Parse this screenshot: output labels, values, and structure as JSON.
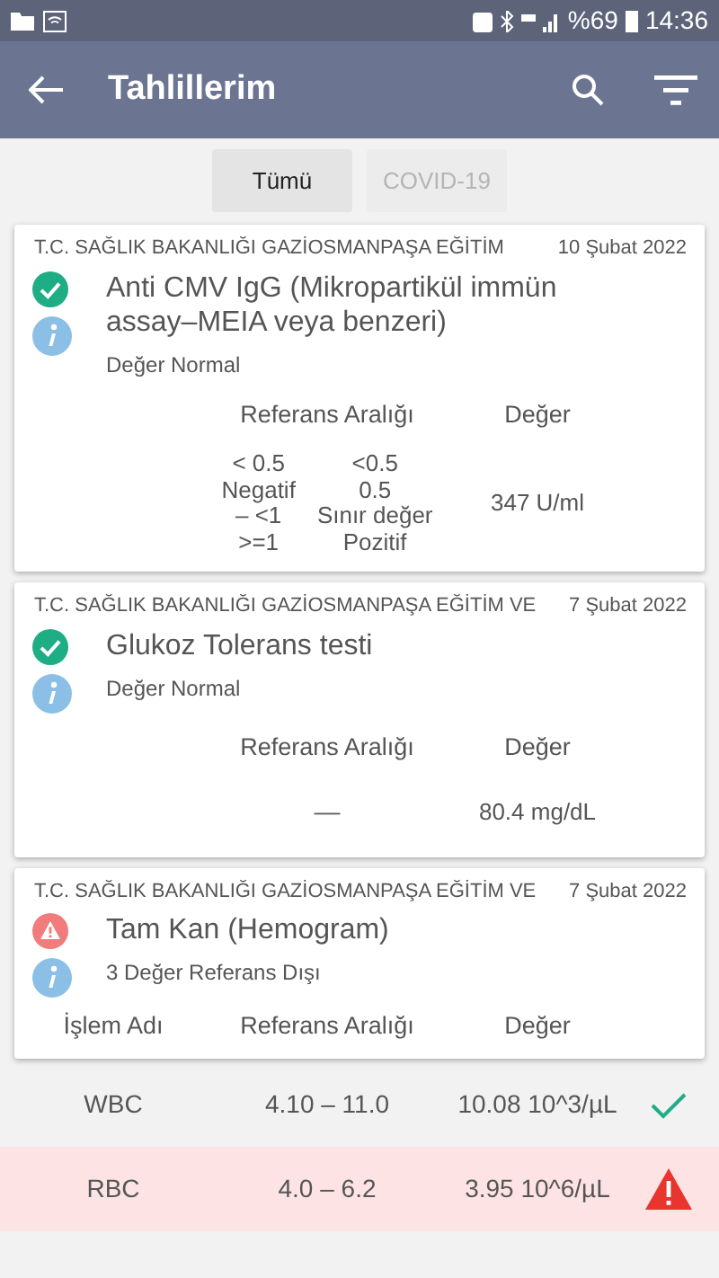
{
  "status_bar": {
    "battery_text": "%69",
    "time": "14:36"
  },
  "app_bar": {
    "title": "Tahlillerim"
  },
  "filters": [
    {
      "label": "Tümü",
      "selected": true
    },
    {
      "label": "COVID-19",
      "selected": false
    }
  ],
  "cards": [
    {
      "source": "T.C. SAĞLIK BAKANLIĞI GAZİOSMANPAŞA EĞİTİM",
      "date": "10 Şubat 2022",
      "title": "Anti CMV IgG (Mikropartikül immün assay–MEIA veya benzeri)",
      "out_of_range": false,
      "summary": "Değer Normal",
      "columns": [
        "Referans Aralığı",
        "Değer"
      ],
      "reference_rows": [
        [
          "< 0.5",
          "<0.5"
        ],
        [
          "Negatif",
          "0.5"
        ],
        [
          "– <1",
          "Sınır değer"
        ],
        [
          ">=1",
          "Pozitif"
        ]
      ],
      "value": "347 U/ml"
    },
    {
      "source": "T.C. SAĞLIK BAKANLIĞI GAZİOSMANPAŞA EĞİTİM VE",
      "date": "7 Şubat 2022",
      "title": "Glukoz Tolerans testi",
      "out_of_range": false,
      "summary": "Değer Normal",
      "columns": [
        "Referans Aralığı",
        "Değer"
      ],
      "reference": "––",
      "value": "80.4 mg/dL"
    },
    {
      "source": "T.C. SAĞLIK BAKANLIĞI GAZİOSMANPAŞA EĞİTİM VE",
      "date": "7 Şubat 2022",
      "title": "Tam Kan (Hemogram)",
      "out_of_range": true,
      "summary": "3 Değer Referans Dışı",
      "columns": [
        "İşlem Adı",
        "Referans Aralığı",
        "Değer"
      ],
      "results": [
        {
          "name": "WBC",
          "reference": "4.10 – 11.0",
          "value": "10.08 10^3/µL",
          "out_of_range": false
        },
        {
          "name": "RBC",
          "reference": "4.0 – 6.2",
          "value": "3.95 10^6/µL",
          "out_of_range": true
        }
      ]
    }
  ]
}
